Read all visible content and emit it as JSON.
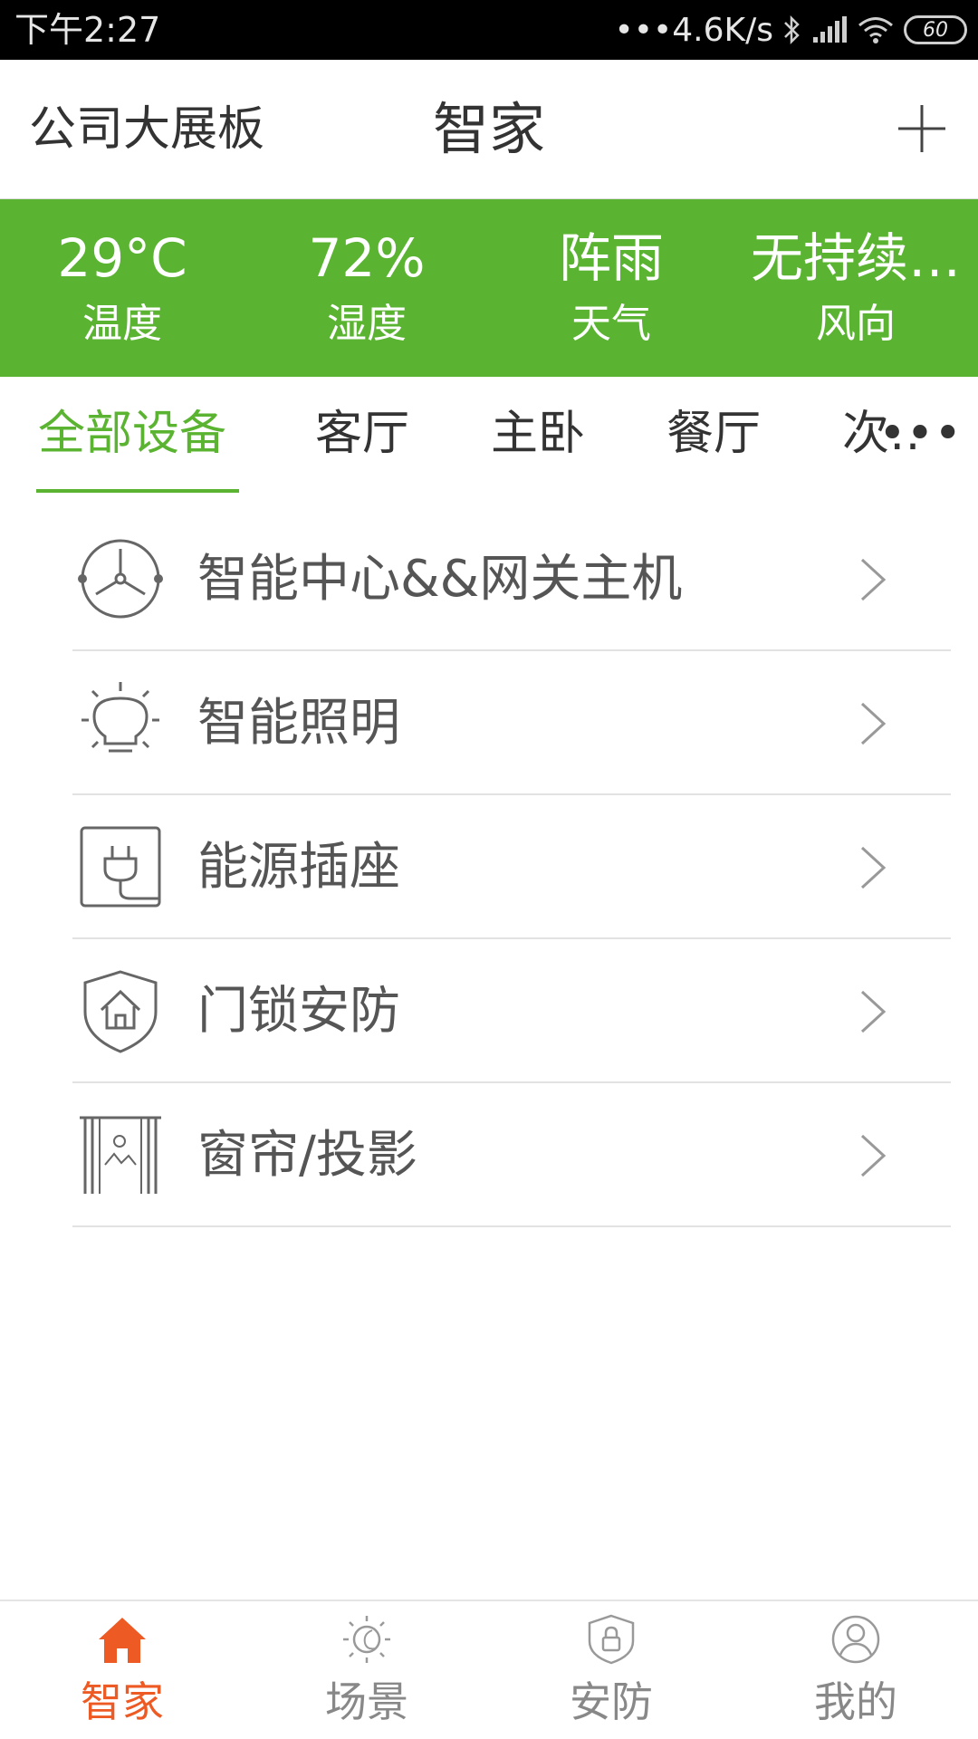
{
  "status_bar": {
    "time": "下午2:27",
    "network_speed": "•••4.6K/s",
    "battery": "60"
  },
  "header": {
    "location": "公司大展板",
    "title": "智家",
    "add_icon": "plus-icon"
  },
  "weather": {
    "temperature": {
      "value": "29°C",
      "label": "温度"
    },
    "humidity": {
      "value": "72%",
      "label": "湿度"
    },
    "condition": {
      "value": "阵雨",
      "label": "天气"
    },
    "wind": {
      "value": "无持续…",
      "label": "风向"
    },
    "background_color": "#5bb431"
  },
  "tabs": {
    "items": [
      {
        "label": "全部设备",
        "active": true
      },
      {
        "label": "客厅",
        "active": false
      },
      {
        "label": "主卧",
        "active": false
      },
      {
        "label": "餐厅",
        "active": false
      },
      {
        "label": "次…",
        "active": false
      }
    ],
    "more": "•••",
    "active_color": "#5bb431"
  },
  "devices": [
    {
      "label": "智能中心&&网关主机",
      "icon": "hub-icon"
    },
    {
      "label": "智能照明",
      "icon": "bulb-icon"
    },
    {
      "label": "能源插座",
      "icon": "plug-icon"
    },
    {
      "label": "门锁安防",
      "icon": "shield-home-icon"
    },
    {
      "label": "窗帘/投影",
      "icon": "curtain-icon"
    }
  ],
  "bottom_nav": {
    "items": [
      {
        "label": "智家",
        "icon": "home-icon",
        "active": true
      },
      {
        "label": "场景",
        "icon": "scene-icon",
        "active": false
      },
      {
        "label": "安防",
        "icon": "security-icon",
        "active": false
      },
      {
        "label": "我的",
        "icon": "profile-icon",
        "active": false
      }
    ],
    "active_color": "#ee5a24"
  }
}
